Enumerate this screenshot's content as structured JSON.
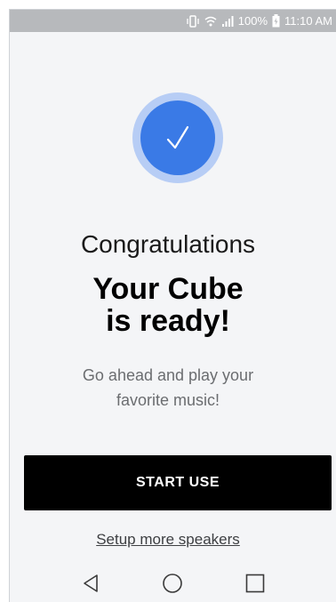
{
  "status_bar": {
    "battery_percent": "100%",
    "time": "11:10 AM",
    "icons": [
      "vibrate-icon",
      "wifi-icon",
      "signal-icon",
      "battery-icon"
    ]
  },
  "hero": {
    "icon": "checkmark-icon",
    "congrats": "Congratulations",
    "headline_line1": "Your Cube",
    "headline_line2": "is ready!",
    "subtext_line1": "Go ahead and play your",
    "subtext_line2": "favorite music!"
  },
  "actions": {
    "start_label": "START USE",
    "setup_link": "Setup more speakers"
  },
  "nav": {
    "icons": [
      "back-icon",
      "home-icon",
      "recents-icon"
    ]
  },
  "colors": {
    "accent": "#3a7ae6",
    "accent_ring": "#b7cdf5",
    "background": "#f4f5f7",
    "button": "#000000",
    "status_bar": "#b7b9bc"
  }
}
